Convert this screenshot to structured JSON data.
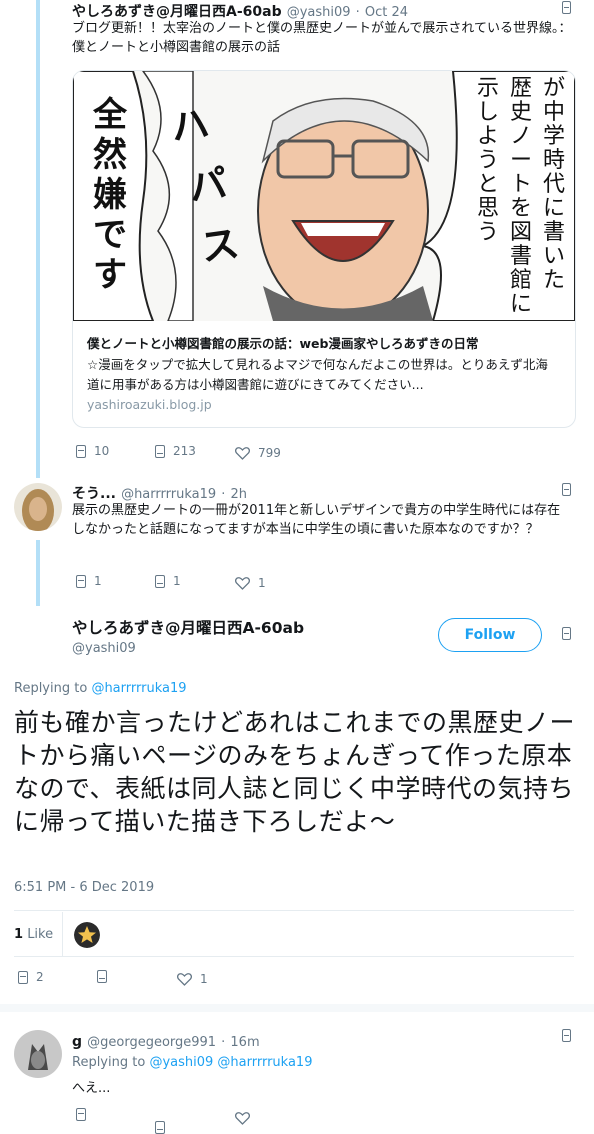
{
  "tweet1": {
    "name": "やしろあずき@月曜日西A-60ab",
    "handle": "@yashi09",
    "sep": "·",
    "date": "Oct 24",
    "text": "ブログ更新！！太宰治のノートと僕の黒歴史ノートが並んで展示されている世界線。：僕とノートと小樽図書館の展示の話",
    "card": {
      "title": "僕とノートと小樽図書館の展示の話：web漫画家やしろあずきの日常",
      "desc": "☆漫画をタップで拡大して見れるよマジで何なんだよこの世界は。とりあえず北海道に用事がある方は小樽図書館に遊びにきてみてください...",
      "domain": "yashiroazuki.blog.jp",
      "image_text_left": "全然嫌です",
      "image_text_mid": "ハパス",
      "image_text_right": "自分が中学時代に書いた黒歴史ノートを図書館に展示しようと思う"
    },
    "actions": {
      "replies": "10",
      "retweets": "213",
      "likes": "799"
    }
  },
  "tweet2": {
    "name": "そう...",
    "handle": "@harrrrruka19",
    "sep": "·",
    "time": "2h",
    "text": "展示の黒歴史ノートの一冊が2011年と新しいデザインで貴方の中学生時代には存在しなかったと話題になってますが本当に中学生の頃に書いた原本なのですか？？",
    "actions": {
      "replies": "1",
      "retweets": "1",
      "likes": "1"
    }
  },
  "main": {
    "name": "やしろあずき@月曜日西A-60ab",
    "handle": "@yashi09",
    "follow_label": "Follow",
    "replying_prefix": "Replying to",
    "replying_to": "@harrrrruka19",
    "text": "前も確か言ったけどあれはこれまでの黒歴史ノートから痛いページのみをちょんぎって作った原本なので、表紙は同人誌と同じく中学時代の気持ちに帰って描いた描き下ろしだよ〜",
    "timestamp": "6:51 PM - 6 Dec 2019",
    "likes_count": "1",
    "likes_label": "Like",
    "actions": {
      "replies": "2",
      "retweets": "",
      "likes": "1"
    }
  },
  "reply3": {
    "name": "g",
    "handle": "@georgegeorge991",
    "sep": "·",
    "time": "16m",
    "replying_prefix": "Replying to",
    "replying_to1": "@yashi09",
    "replying_to2": "@harrrrruka19",
    "text": "へえ..."
  },
  "colors": {
    "accent": "#1da1f2",
    "thread": "#b3dff7",
    "muted": "#657786",
    "border": "#e1e8ed"
  }
}
